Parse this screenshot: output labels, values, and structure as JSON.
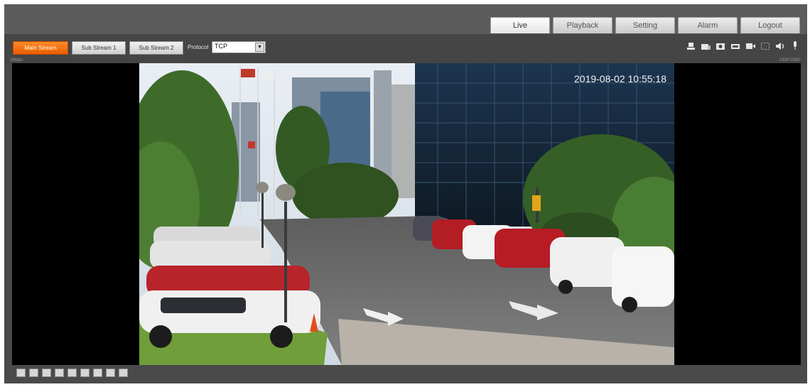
{
  "nav": {
    "tabs": [
      {
        "label": "Live",
        "active": true
      },
      {
        "label": "Playback",
        "active": false
      },
      {
        "label": "Setting",
        "active": false
      },
      {
        "label": "Alarm",
        "active": false
      },
      {
        "label": "Logout",
        "active": false
      }
    ]
  },
  "toolbar": {
    "main_stream": "Main Stream",
    "sub_stream_1": "Sub Stream 1",
    "sub_stream_2": "Sub Stream 2",
    "protocol_label": "Protocol",
    "protocol_value": "TCP",
    "left_info": "2Mbps",
    "right_info": "1920*1080",
    "icons": [
      "alarm-output-icon",
      "snapshot-settings-icon",
      "snapshot-icon",
      "triple-snapshot-icon",
      "record-icon",
      "zoom-icon",
      "audio-icon",
      "microphone-icon"
    ]
  },
  "video": {
    "timestamp": "2019-08-02 10:55:18"
  },
  "bottom_icons": [
    "ptz-icon",
    "original-size-icon",
    "fullscreen-icon",
    "width-height-ratio-icon",
    "fluency-icon",
    "rule-info-icon",
    "window-split-icon",
    "zoom-focus-icon",
    "fisheye-icon"
  ],
  "colors": {
    "accent": "#f07010",
    "frame": "#4a4a4a"
  }
}
